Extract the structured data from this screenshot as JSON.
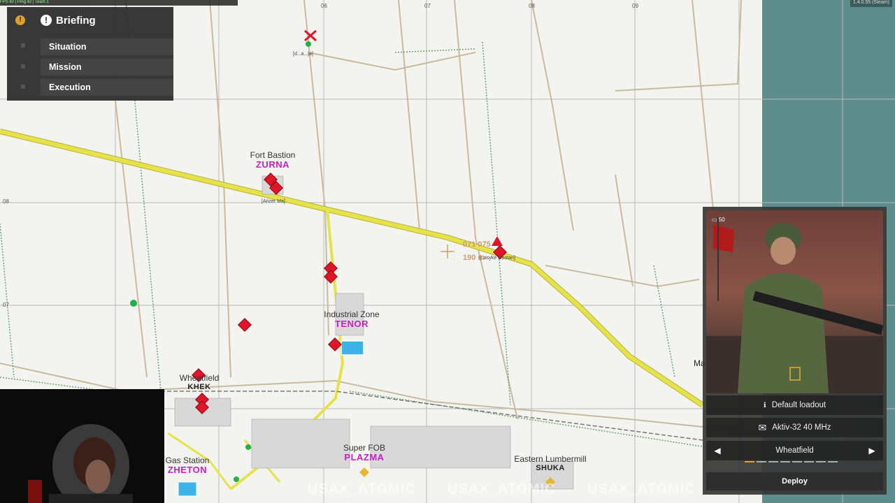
{
  "briefing": {
    "title": "Briefing",
    "items": [
      "Situation",
      "Mission",
      "Execution"
    ]
  },
  "map": {
    "locations": [
      {
        "sub": "Fort Bastion",
        "name": "ZURNA",
        "style": "obj"
      },
      {
        "sub": "Industrial Zone",
        "name": "TENOR",
        "style": "obj"
      },
      {
        "sub": "Wheatfield",
        "name": "KHEK",
        "style": "plain"
      },
      {
        "sub": "Super FOB",
        "name": "PLAZMA",
        "style": "obj"
      },
      {
        "sub": "Gas Station",
        "name": "ZHETON",
        "style": "obj"
      },
      {
        "sub": "Eastern Lumbermill",
        "name": "SHUKA",
        "style": "plain"
      }
    ],
    "grid_labels": [
      "06",
      "07",
      "08",
      "09",
      "08",
      "07"
    ],
    "coord_text": "071 075",
    "range_text": "190 m",
    "edge_text": "Ma",
    "small_labels": [
      "[Arizer Ma]",
      "[Lasyke Obotan]",
      "[d...a...ja]"
    ],
    "watermark": "USAX_ATOMIC"
  },
  "topbar": {
    "left_text": "FPS 60 | Ping 42 | Team 1",
    "right_text": "1.4.0.55 (Steam)"
  },
  "deploy": {
    "ammo_count": "50",
    "loadout": "Default loadout",
    "radio": "Aktiv-32 40 MHz",
    "spawn_point": "Wheatfield",
    "deploy_label": "Deploy",
    "pager_index": 0,
    "pager_total": 8
  },
  "colors": {
    "road_yellow": "#e5e24a",
    "objective_magenta": "#c81dc8",
    "enemy_red": "#e0152a",
    "friendly_blue": "#3cb3e6",
    "sea": "#5f8c8c"
  },
  "icons": {
    "briefing_alert": "exclamation-icon",
    "envelope": "envelope-icon",
    "prev": "left-arrow-icon",
    "next": "right-arrow-icon"
  }
}
